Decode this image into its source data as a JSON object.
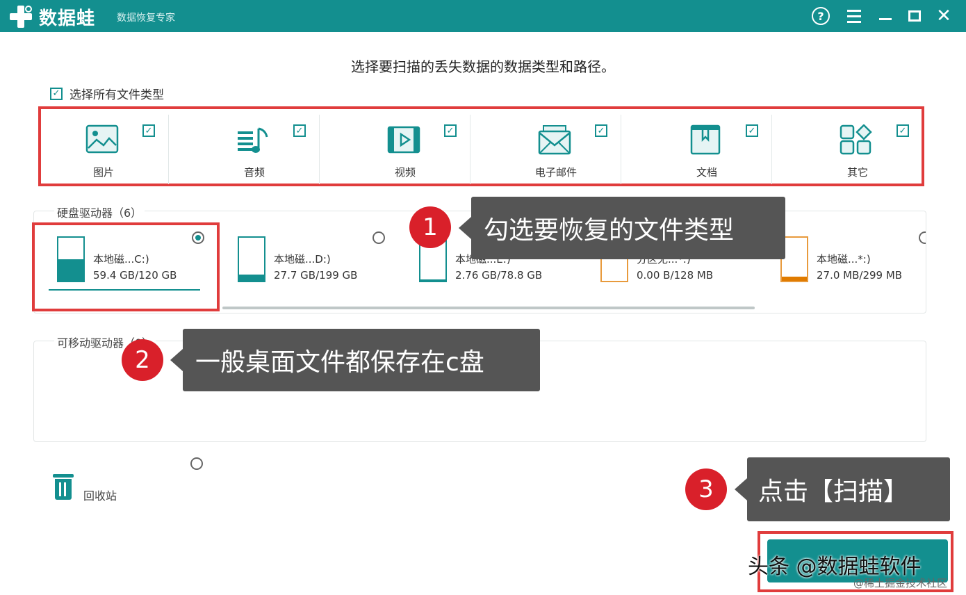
{
  "app": {
    "name": "数据蛙",
    "subtitle": "数据恢复专家"
  },
  "window_controls": {
    "help": "?",
    "close": "✕"
  },
  "heading": "选择要扫描的丢失数据的数据类型和路径。",
  "select_all_label": "选择所有文件类型",
  "file_types": [
    {
      "label": "图片",
      "icon": "image-icon",
      "checked": true
    },
    {
      "label": "音频",
      "icon": "audio-icon",
      "checked": true
    },
    {
      "label": "视频",
      "icon": "video-icon",
      "checked": true
    },
    {
      "label": "电子邮件",
      "icon": "email-icon",
      "checked": true
    },
    {
      "label": "文档",
      "icon": "document-icon",
      "checked": true
    },
    {
      "label": "其它",
      "icon": "other-icon",
      "checked": true
    }
  ],
  "hdd_section": {
    "label": "硬盘驱动器（6）",
    "drives": [
      {
        "name": "本地磁...C:)",
        "size": "59.4 GB/120 GB",
        "selected": true,
        "fill": 0.5
      },
      {
        "name": "本地磁...D:)",
        "size": "27.7 GB/199 GB",
        "selected": false,
        "fill": 0.14
      },
      {
        "name": "本地磁...E:)",
        "size": "2.76 GB/78.8 GB",
        "selected": false,
        "fill": 0.04
      },
      {
        "name": "分区无...*:)",
        "size": "0.00  B/128 MB",
        "selected": false,
        "fill": 0
      },
      {
        "name": "本地磁...*:)",
        "size": "27.0 MB/299 MB",
        "selected": false,
        "fill": 0.09
      }
    ]
  },
  "removable_section": {
    "label": "可移动驱动器（0）"
  },
  "recycle_bin_label": "回收站",
  "callouts": [
    {
      "num": "1",
      "text": "勾选要恢复的文件类型"
    },
    {
      "num": "2",
      "text": "一般桌面文件都保存在c盘"
    },
    {
      "num": "3",
      "text": "点击【扫描】"
    }
  ],
  "watermark": "头条 @数据蛙软件",
  "watermark_small": "@稀土掘金技术社区",
  "colors": {
    "brand": "#138f8f",
    "highlight": "#e03c3c",
    "callout_bg": "#555555",
    "badge": "#d9202a"
  }
}
